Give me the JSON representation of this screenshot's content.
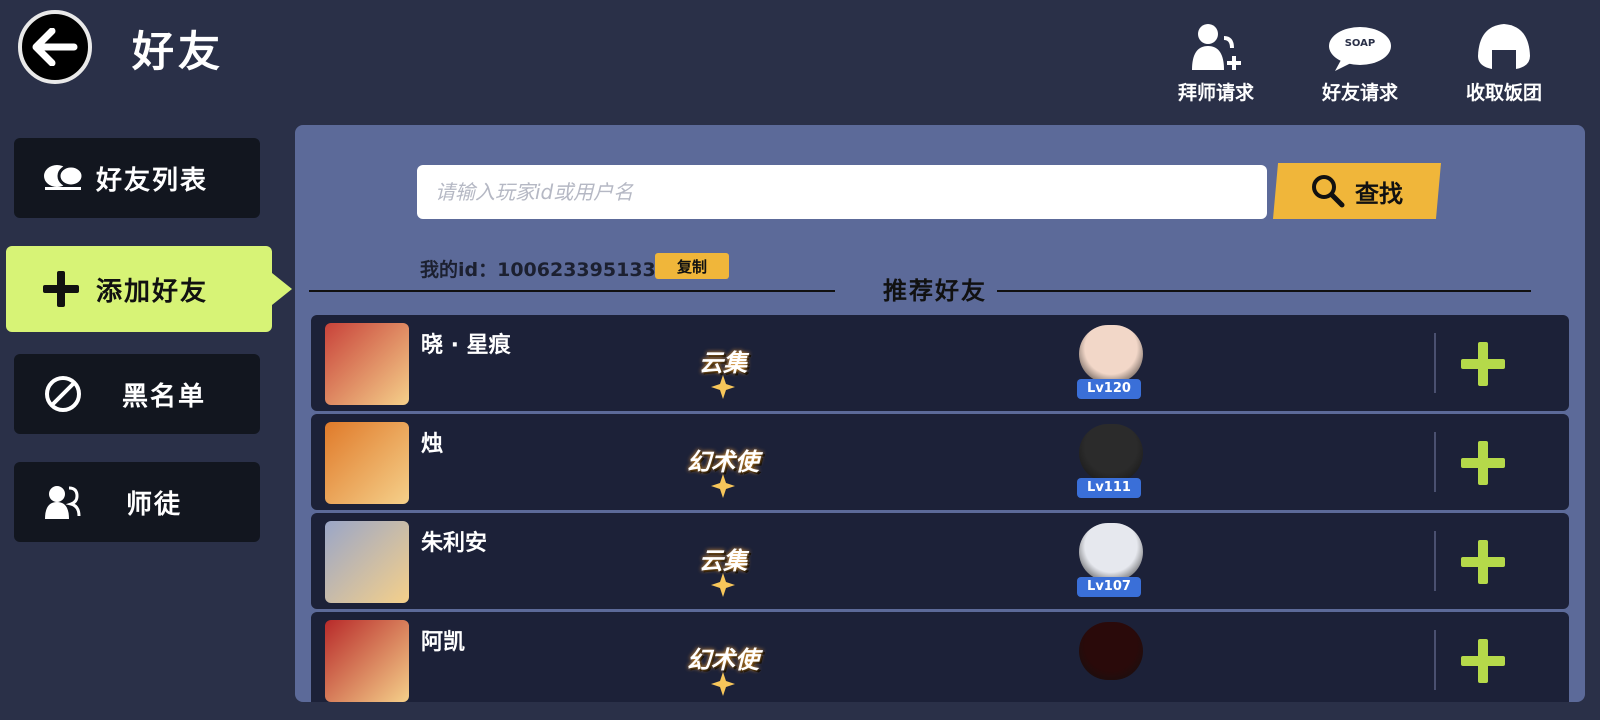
{
  "header": {
    "title": "好友",
    "actions": [
      {
        "label": "拜师请求",
        "icon": "mentor-request-icon"
      },
      {
        "label": "好友请求",
        "icon": "friend-request-icon"
      },
      {
        "label": "收取饭团",
        "icon": "rice-ball-icon"
      }
    ]
  },
  "sidebar": {
    "items": [
      {
        "label": "好友列表",
        "icon": "friends-list-icon"
      },
      {
        "label": "添加好友",
        "icon": "plus-icon",
        "active": true
      },
      {
        "label": "黑名单",
        "icon": "block-icon"
      },
      {
        "label": "师徒",
        "icon": "mentor-icon"
      }
    ]
  },
  "search": {
    "placeholder": "请输入玩家id或用户名",
    "button_label": "查找"
  },
  "my_id": {
    "text": "我的id：100623395133",
    "copy_label": "复制"
  },
  "recommend": {
    "title": "推荐好友",
    "friends": [
      {
        "name": "晓 · 星痕",
        "title_badge": "云集",
        "level": "Lv120",
        "avatar_color": "#c8423a",
        "char_color": "#f2d7c8"
      },
      {
        "name": "烛",
        "title_badge": "幻术使",
        "level": "Lv111",
        "avatar_color": "#e07a2a",
        "char_color": "#2b2b2b"
      },
      {
        "name": "朱利安",
        "title_badge": "云集",
        "level": "Lv107",
        "avatar_color": "#9aa6c8",
        "char_color": "#e6e8ee"
      },
      {
        "name": "阿凯",
        "title_badge": "幻术使",
        "level": "",
        "avatar_color": "#b82a2a",
        "char_color": "#2a0a0a"
      }
    ]
  },
  "colors": {
    "background": "#2a3048",
    "panel": "#5c6a99",
    "active_tab": "#d7f376",
    "accent_yellow": "#f0b63a",
    "add_green": "#b5d94a",
    "level_blue": "#3a6fd8"
  }
}
